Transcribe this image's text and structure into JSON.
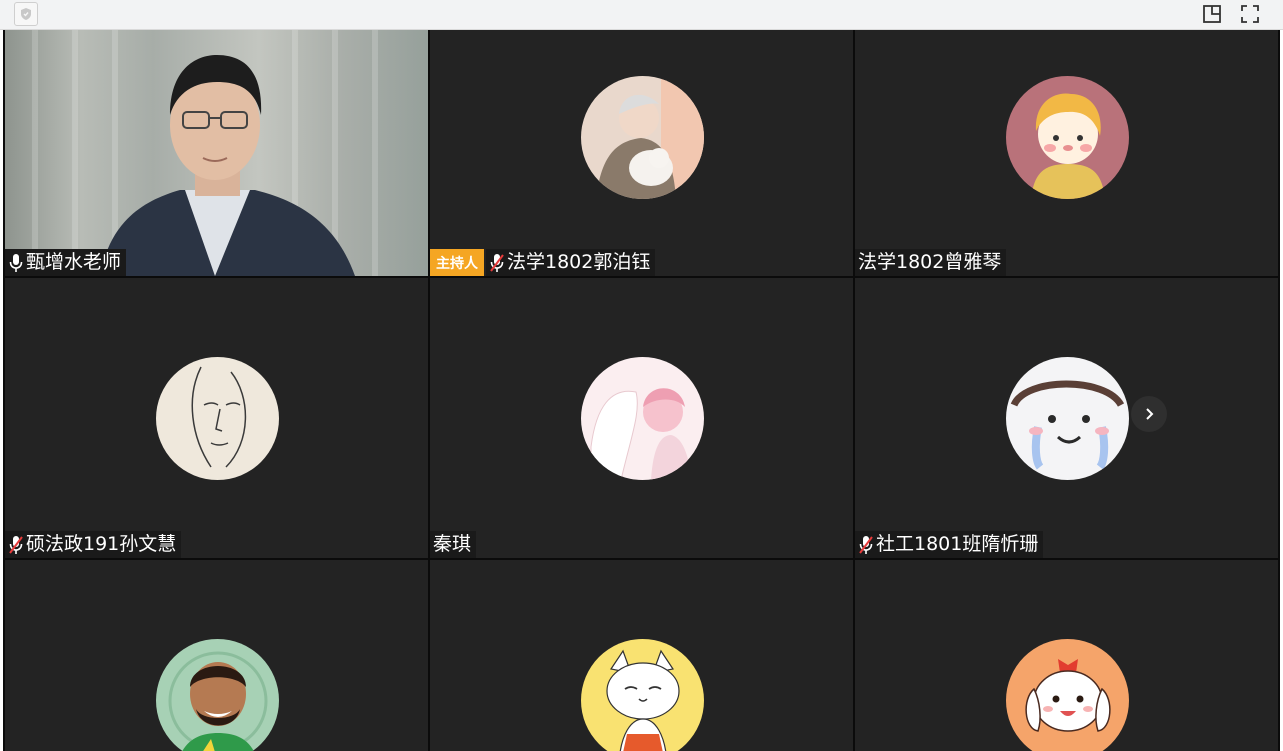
{
  "toolbar": {
    "left_icon": "shield-icon",
    "right_icons": [
      "layout-icon",
      "fullscreen-icon"
    ]
  },
  "participants": [
    {
      "name": "甄增水老师",
      "mic": "on",
      "video": true
    },
    {
      "name": "法学1802郭泊钰",
      "mic": "muted",
      "host_badge": "主持人",
      "avatar": "photo-person-with-dog"
    },
    {
      "name": "法学1802曾雅琴",
      "mic": "none",
      "avatar": "cartoon-girl"
    },
    {
      "name": "硕法政191孙文慧",
      "mic": "muted",
      "avatar": "line-drawing-face"
    },
    {
      "name": "秦琪",
      "mic": "none",
      "avatar": "pink-illustration-cat-girl"
    },
    {
      "name": "社工1801班隋忻珊",
      "mic": "muted",
      "avatar": "crying-cartoon-face"
    },
    {
      "name": "",
      "mic": "none",
      "avatar": "cartoon-footballer"
    },
    {
      "name": "",
      "mic": "none",
      "avatar": "cartoon-cat"
    },
    {
      "name": "",
      "mic": "none",
      "avatar": "cartoon-puppy"
    }
  ],
  "colors": {
    "tile_bg": "#232323",
    "host_badge": "#f5a623",
    "label_bg": "#1a1a1a"
  }
}
